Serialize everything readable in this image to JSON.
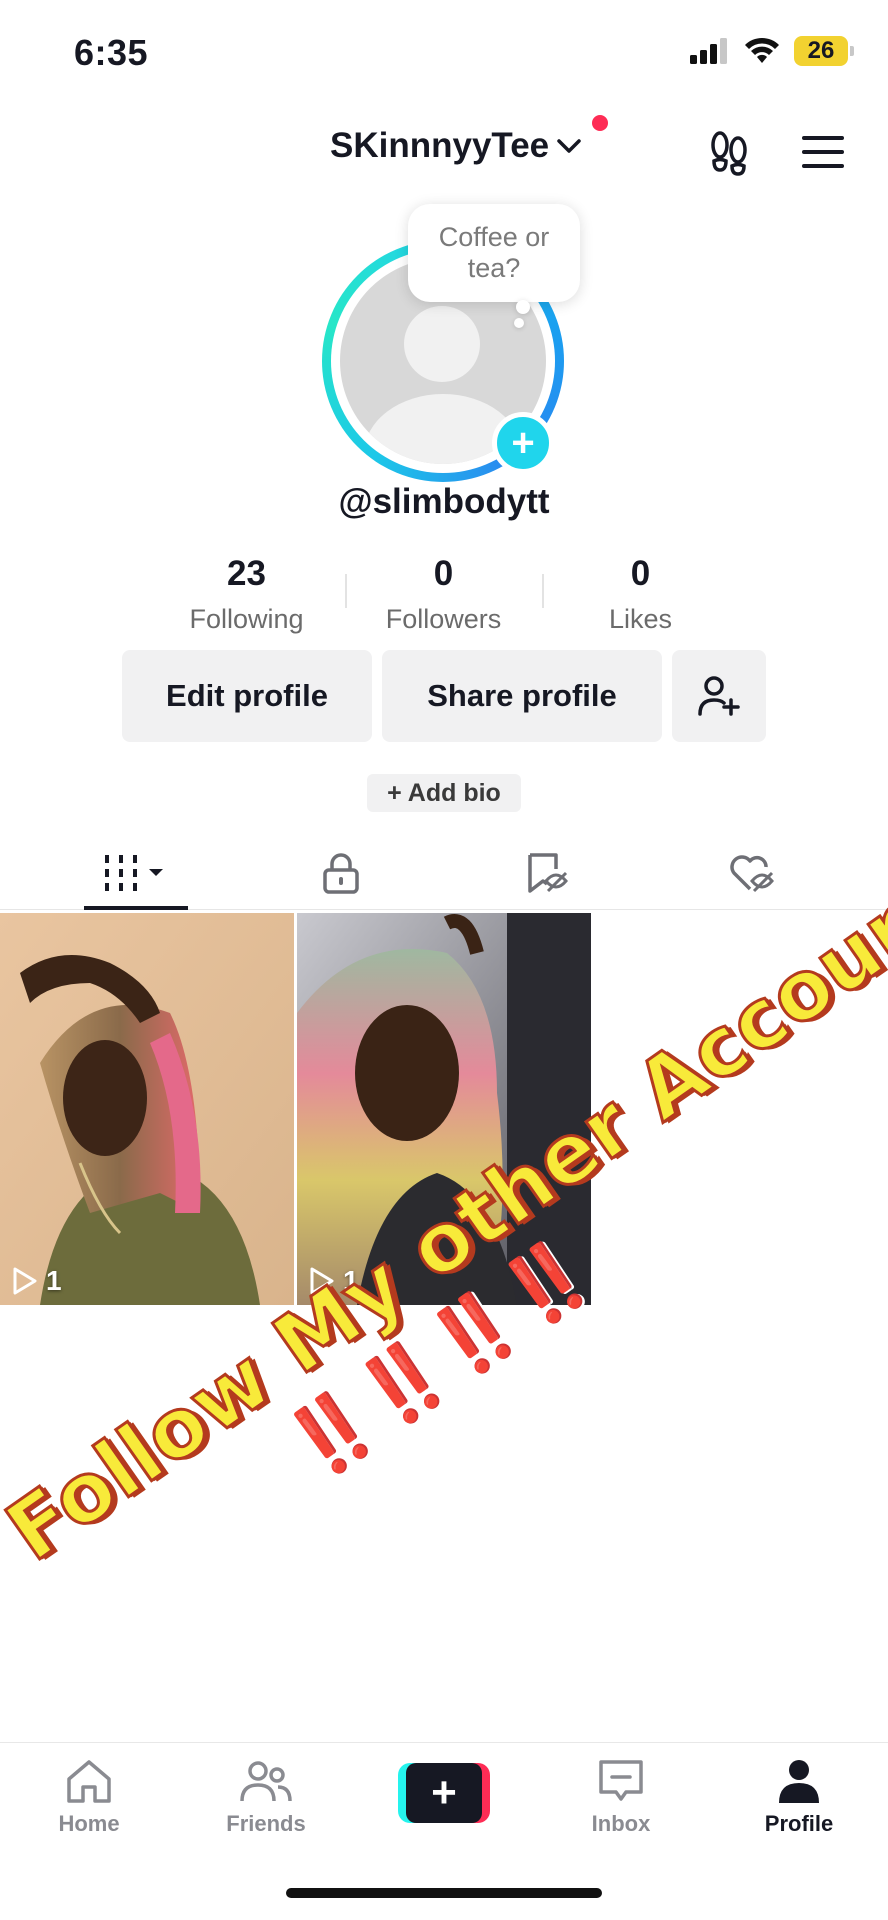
{
  "status_bar": {
    "time": "6:35",
    "battery": "26"
  },
  "header": {
    "username": "SKinnnyyTee"
  },
  "profile": {
    "bubble_text": "Coffee or tea?",
    "handle": "@slimbodytt"
  },
  "stats": [
    {
      "value": "23",
      "label": "Following"
    },
    {
      "value": "0",
      "label": "Followers"
    },
    {
      "value": "0",
      "label": "Likes"
    }
  ],
  "actions": {
    "edit": "Edit profile",
    "share": "Share profile"
  },
  "add_bio": "+ Add bio",
  "videos": [
    {
      "views": "1"
    },
    {
      "views": "1"
    }
  ],
  "overlay": {
    "line1": "Follow My other Account",
    "line2": "‼️‼️‼️‼️"
  },
  "nav": [
    {
      "label": "Home"
    },
    {
      "label": "Friends"
    },
    {
      "label": "Inbox"
    },
    {
      "label": "Profile"
    }
  ],
  "colors": {
    "accent_pink": "#fe2c55",
    "accent_cyan": "#25f4ee",
    "avatar_add": "#20d5ec",
    "text": "#161823"
  }
}
